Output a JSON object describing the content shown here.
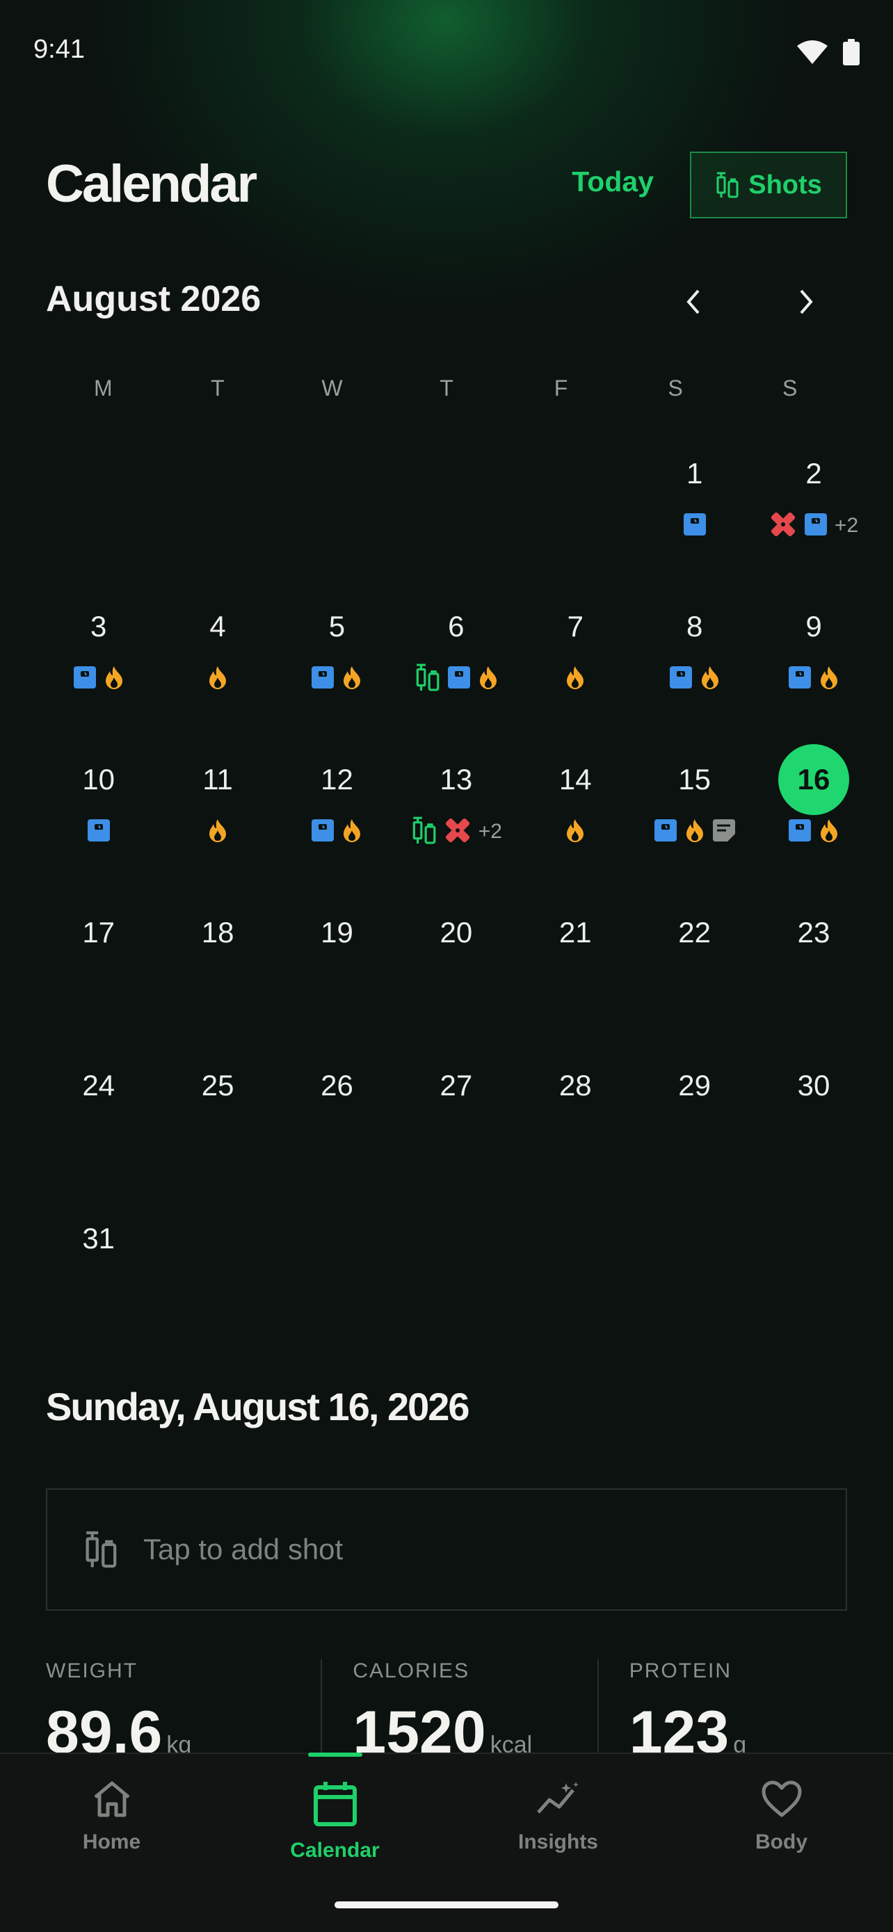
{
  "status_bar": {
    "time": "9:41"
  },
  "header": {
    "title": "Calendar",
    "today_label": "Today",
    "shots_label": "Shots"
  },
  "month": {
    "label": "August 2026"
  },
  "weekdays": [
    "M",
    "T",
    "W",
    "T",
    "F",
    "S",
    "S"
  ],
  "selected_day": 16,
  "days": [
    {
      "n": "",
      "m": []
    },
    {
      "n": "",
      "m": []
    },
    {
      "n": "",
      "m": []
    },
    {
      "n": "",
      "m": []
    },
    {
      "n": "",
      "m": []
    },
    {
      "n": "1",
      "m": [
        "scale"
      ]
    },
    {
      "n": "2",
      "m": [
        "patch",
        "scale"
      ],
      "more": "+2"
    },
    {
      "n": "3",
      "m": [
        "scale",
        "flame"
      ]
    },
    {
      "n": "4",
      "m": [
        "flame"
      ]
    },
    {
      "n": "5",
      "m": [
        "scale",
        "flame"
      ]
    },
    {
      "n": "6",
      "m": [
        "syringe",
        "scale",
        "flame"
      ]
    },
    {
      "n": "7",
      "m": [
        "flame"
      ]
    },
    {
      "n": "8",
      "m": [
        "scale",
        "flame"
      ]
    },
    {
      "n": "9",
      "m": [
        "scale",
        "flame"
      ]
    },
    {
      "n": "10",
      "m": [
        "scale"
      ]
    },
    {
      "n": "11",
      "m": [
        "flame"
      ]
    },
    {
      "n": "12",
      "m": [
        "scale",
        "flame"
      ]
    },
    {
      "n": "13",
      "m": [
        "syringe",
        "patch"
      ],
      "more": "+2"
    },
    {
      "n": "14",
      "m": [
        "flame"
      ]
    },
    {
      "n": "15",
      "m": [
        "scale",
        "flame",
        "note"
      ]
    },
    {
      "n": "16",
      "m": [
        "scale",
        "flame"
      ]
    },
    {
      "n": "17",
      "m": []
    },
    {
      "n": "18",
      "m": []
    },
    {
      "n": "19",
      "m": []
    },
    {
      "n": "20",
      "m": []
    },
    {
      "n": "21",
      "m": []
    },
    {
      "n": "22",
      "m": []
    },
    {
      "n": "23",
      "m": []
    },
    {
      "n": "24",
      "m": []
    },
    {
      "n": "25",
      "m": []
    },
    {
      "n": "26",
      "m": []
    },
    {
      "n": "27",
      "m": []
    },
    {
      "n": "28",
      "m": []
    },
    {
      "n": "29",
      "m": []
    },
    {
      "n": "30",
      "m": []
    },
    {
      "n": "31",
      "m": []
    }
  ],
  "marker_colors": {
    "scale": "#3d8fe8",
    "flame": "#f5a524",
    "syringe": "#1fd06a",
    "patch": "#e5484d",
    "note": "#8a8f8b"
  },
  "selected_date": {
    "heading": "Sunday, August 16, 2026"
  },
  "add_shot": {
    "placeholder": "Tap to add shot"
  },
  "stats": [
    {
      "label": "WEIGHT",
      "value": "89.6",
      "unit": "kg"
    },
    {
      "label": "CALORIES",
      "value": "1520",
      "unit": "kcal"
    },
    {
      "label": "PROTEIN",
      "value": "123",
      "unit": "g"
    }
  ],
  "tabs": [
    {
      "label": "Home",
      "icon": "home-icon"
    },
    {
      "label": "Calendar",
      "icon": "calendar-icon",
      "active": true
    },
    {
      "label": "Insights",
      "icon": "insights-icon"
    },
    {
      "label": "Body",
      "icon": "heart-icon"
    }
  ]
}
